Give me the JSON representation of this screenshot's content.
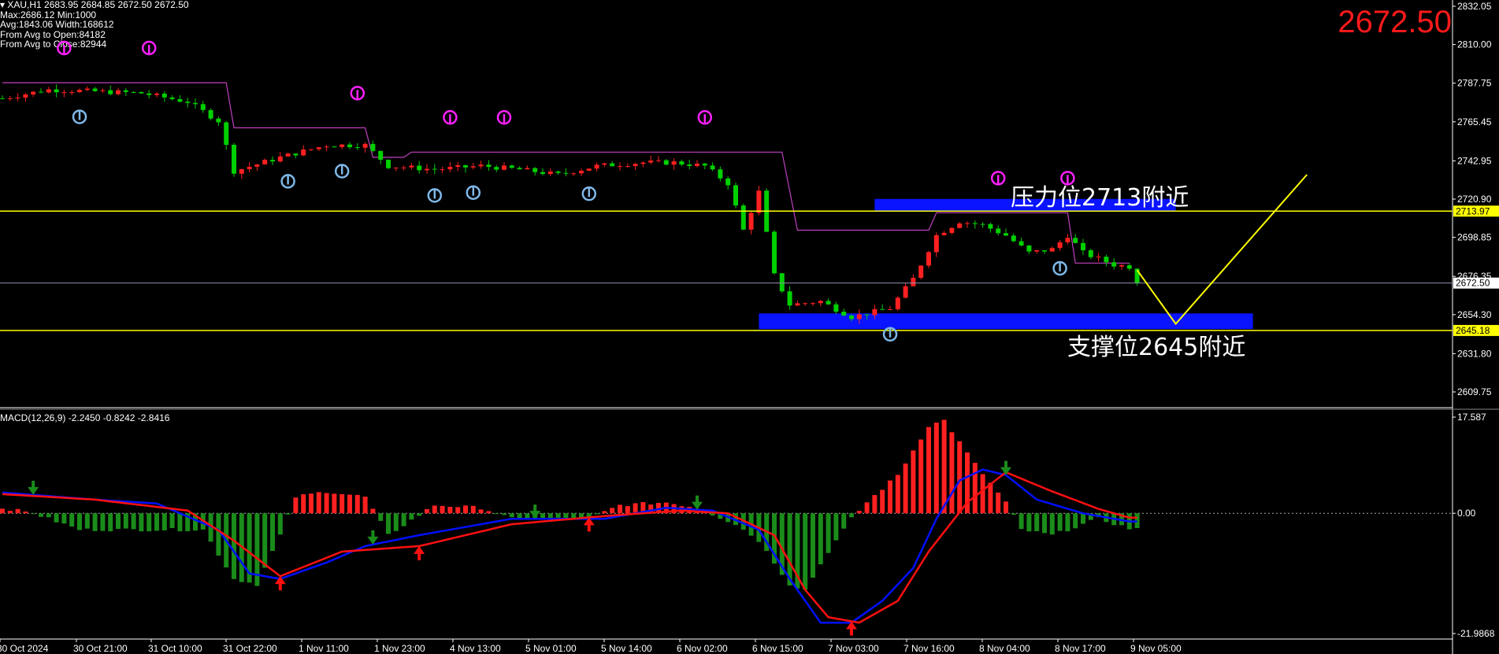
{
  "header": {
    "symbol": "XAU,H1  2683.95 2684.85 2672.50 2672.50",
    "line2": "Max:2686.12 Min:1000",
    "line3": "Avg:1843.06 Width:168612",
    "line4": "From Avg to Open:84182",
    "line5": "From Avg to Close:82944"
  },
  "current_price": "2672.50",
  "resistance_label": "压力位2713附近",
  "support_label": "支撑位2645附近",
  "macd_label": "MACD(12,26,9) -2.2450 -0.8242 -2.8416",
  "colors": {
    "bull_candle": "#ff2020",
    "bear_candle": "#00d000",
    "zone": "#0a14ff",
    "level_line": "#ffff00",
    "trail_line": "#c040c0",
    "macd_line": "#0010ff",
    "signal_line": "#ff1010",
    "hist_pos": "#ff2020",
    "hist_neg": "#1a8c1a"
  },
  "chart_data": [
    {
      "type": "candlestick",
      "ylim": [
        2597,
        2832
      ],
      "y_ticks": [
        "2832.05",
        "2810.00",
        "2787.75",
        "2765.45",
        "2742.95",
        "2720.90",
        "2698.85",
        "2676.35",
        "2654.30",
        "2631.80",
        "2609.75"
      ],
      "x_ticks": [
        "30 Oct 2024",
        "30 Oct 21:00",
        "31 Oct 10:00",
        "31 Oct 22:00",
        "1 Nov 11:00",
        "1 Nov 23:00",
        "4 Nov 13:00",
        "5 Nov 01:00",
        "5 Nov 14:00",
        "6 Nov 02:00",
        "6 Nov 15:00",
        "7 Nov 03:00",
        "7 Nov 16:00",
        "8 Nov 04:00",
        "8 Nov 17:00",
        "9 Nov 05:00"
      ],
      "levels": [
        {
          "label": "2713.97",
          "value": 2713.97
        },
        {
          "label": "2672.50",
          "value": 2672.5
        },
        {
          "label": "2645.18",
          "value": 2645.18
        }
      ],
      "zones": [
        {
          "name": "resistance",
          "from_index": 113,
          "to_index": 152,
          "low": 2714,
          "high": 2721
        },
        {
          "name": "support",
          "from_index": 98,
          "to_index": 162,
          "low": 2646,
          "high": 2655
        }
      ],
      "projection": [
        {
          "index": 147,
          "value": 2680
        },
        {
          "index": 152,
          "value": 2649
        },
        {
          "index": 169,
          "value": 2735
        }
      ],
      "close_path": [
        {
          "index": 0,
          "value": 2779
        },
        {
          "index": 6,
          "value": 2784
        },
        {
          "index": 12,
          "value": 2783
        },
        {
          "index": 18,
          "value": 2782
        },
        {
          "index": 24,
          "value": 2777
        },
        {
          "index": 28,
          "value": 2766
        },
        {
          "index": 30,
          "value": 2737
        },
        {
          "index": 36,
          "value": 2745
        },
        {
          "index": 42,
          "value": 2752
        },
        {
          "index": 47,
          "value": 2752
        },
        {
          "index": 50,
          "value": 2740
        },
        {
          "index": 56,
          "value": 2738
        },
        {
          "index": 62,
          "value": 2740
        },
        {
          "index": 67,
          "value": 2738
        },
        {
          "index": 72,
          "value": 2735
        },
        {
          "index": 77,
          "value": 2740
        },
        {
          "index": 83,
          "value": 2742
        },
        {
          "index": 87,
          "value": 2742
        },
        {
          "index": 91,
          "value": 2740
        },
        {
          "index": 94,
          "value": 2730
        },
        {
          "index": 96,
          "value": 2703
        },
        {
          "index": 98,
          "value": 2725
        },
        {
          "index": 100,
          "value": 2677
        },
        {
          "index": 102,
          "value": 2660
        },
        {
          "index": 106,
          "value": 2662
        },
        {
          "index": 110,
          "value": 2653
        },
        {
          "index": 115,
          "value": 2658
        },
        {
          "index": 118,
          "value": 2675
        },
        {
          "index": 121,
          "value": 2700
        },
        {
          "index": 124,
          "value": 2708
        },
        {
          "index": 127,
          "value": 2706
        },
        {
          "index": 130,
          "value": 2700
        },
        {
          "index": 133,
          "value": 2690
        },
        {
          "index": 136,
          "value": 2692
        },
        {
          "index": 138,
          "value": 2700
        },
        {
          "index": 140,
          "value": 2690
        },
        {
          "index": 144,
          "value": 2683
        },
        {
          "index": 146,
          "value": 2682
        },
        {
          "index": 147,
          "value": 2672.5
        }
      ],
      "trail_line": [
        {
          "index": 0,
          "value": 2788
        },
        {
          "index": 29,
          "value": 2788
        },
        {
          "index": 30,
          "value": 2762
        },
        {
          "index": 47,
          "value": 2762
        },
        {
          "index": 48,
          "value": 2745
        },
        {
          "index": 52,
          "value": 2745
        },
        {
          "index": 53,
          "value": 2748
        },
        {
          "index": 101,
          "value": 2748
        },
        {
          "index": 103,
          "value": 2703
        },
        {
          "index": 120,
          "value": 2703
        },
        {
          "index": 121,
          "value": 2713
        },
        {
          "index": 138,
          "value": 2713
        },
        {
          "index": 139,
          "value": 2684
        },
        {
          "index": 146,
          "value": 2684
        }
      ],
      "top_markers": [
        8,
        19,
        46,
        58,
        65,
        91,
        129,
        138
      ],
      "bottom_markers": [
        10,
        37,
        44,
        56,
        61,
        76,
        115,
        137
      ]
    },
    {
      "type": "macd",
      "title": "MACD(12,26,9)",
      "values": {
        "macd": -2.245,
        "signal": -0.8242,
        "histogram": -2.8416
      },
      "ylim": [
        -21.9868,
        17.587
      ],
      "y_ticks": [
        "17.587",
        "0.00",
        "-21.9868"
      ],
      "macd_path": [
        {
          "index": 0,
          "value": 3.8
        },
        {
          "index": 12,
          "value": 2.5
        },
        {
          "index": 20,
          "value": 1.8
        },
        {
          "index": 28,
          "value": -3
        },
        {
          "index": 32,
          "value": -11
        },
        {
          "index": 36,
          "value": -12
        },
        {
          "index": 42,
          "value": -9
        },
        {
          "index": 47,
          "value": -6
        },
        {
          "index": 54,
          "value": -4
        },
        {
          "index": 66,
          "value": -1
        },
        {
          "index": 78,
          "value": -1
        },
        {
          "index": 86,
          "value": 1
        },
        {
          "index": 92,
          "value": 0.5
        },
        {
          "index": 98,
          "value": -3
        },
        {
          "index": 102,
          "value": -12
        },
        {
          "index": 106,
          "value": -20
        },
        {
          "index": 110,
          "value": -20
        },
        {
          "index": 114,
          "value": -16
        },
        {
          "index": 118,
          "value": -10
        },
        {
          "index": 121,
          "value": -1
        },
        {
          "index": 124,
          "value": 6
        },
        {
          "index": 127,
          "value": 8
        },
        {
          "index": 130,
          "value": 7
        },
        {
          "index": 134,
          "value": 2.5
        },
        {
          "index": 140,
          "value": 0
        },
        {
          "index": 146,
          "value": -1.5
        }
      ],
      "signal_path": [
        {
          "index": 0,
          "value": 3.5
        },
        {
          "index": 12,
          "value": 2.5
        },
        {
          "index": 24,
          "value": 0.5
        },
        {
          "index": 30,
          "value": -5
        },
        {
          "index": 36,
          "value": -11.5
        },
        {
          "index": 44,
          "value": -7
        },
        {
          "index": 54,
          "value": -6
        },
        {
          "index": 66,
          "value": -2
        },
        {
          "index": 78,
          "value": -0.5
        },
        {
          "index": 88,
          "value": 0.5
        },
        {
          "index": 94,
          "value": 0
        },
        {
          "index": 100,
          "value": -4
        },
        {
          "index": 104,
          "value": -14
        },
        {
          "index": 107,
          "value": -19
        },
        {
          "index": 111,
          "value": -20
        },
        {
          "index": 116,
          "value": -16
        },
        {
          "index": 120,
          "value": -7
        },
        {
          "index": 125,
          "value": 2
        },
        {
          "index": 130,
          "value": 7.5
        },
        {
          "index": 136,
          "value": 4
        },
        {
          "index": 142,
          "value": 0.8
        },
        {
          "index": 146,
          "value": -0.8
        }
      ],
      "hist_path": [
        {
          "index": 0,
          "value": 1
        },
        {
          "index": 4,
          "value": 0
        },
        {
          "index": 10,
          "value": -3
        },
        {
          "index": 18,
          "value": -3
        },
        {
          "index": 26,
          "value": -3
        },
        {
          "index": 30,
          "value": -12
        },
        {
          "index": 33,
          "value": -13
        },
        {
          "index": 36,
          "value": -4
        },
        {
          "index": 38,
          "value": 3
        },
        {
          "index": 42,
          "value": 4
        },
        {
          "index": 47,
          "value": 3
        },
        {
          "index": 50,
          "value": -4
        },
        {
          "index": 56,
          "value": 1.5
        },
        {
          "index": 62,
          "value": 1
        },
        {
          "index": 66,
          "value": -1
        },
        {
          "index": 76,
          "value": -1
        },
        {
          "index": 80,
          "value": 1.5
        },
        {
          "index": 86,
          "value": 2
        },
        {
          "index": 90,
          "value": 1
        },
        {
          "index": 95,
          "value": -2
        },
        {
          "index": 98,
          "value": -5
        },
        {
          "index": 102,
          "value": -13
        },
        {
          "index": 104,
          "value": -14
        },
        {
          "index": 107,
          "value": -7
        },
        {
          "index": 110,
          "value": -1
        },
        {
          "index": 112,
          "value": 2
        },
        {
          "index": 116,
          "value": 7
        },
        {
          "index": 120,
          "value": 16
        },
        {
          "index": 122,
          "value": 17
        },
        {
          "index": 126,
          "value": 9
        },
        {
          "index": 130,
          "value": 2
        },
        {
          "index": 132,
          "value": -3
        },
        {
          "index": 136,
          "value": -4
        },
        {
          "index": 142,
          "value": -1
        },
        {
          "index": 146,
          "value": -2.8
        }
      ],
      "up_arrows": [
        36,
        54,
        76,
        110
      ],
      "down_arrows": [
        4,
        48,
        69,
        90,
        130
      ]
    }
  ]
}
